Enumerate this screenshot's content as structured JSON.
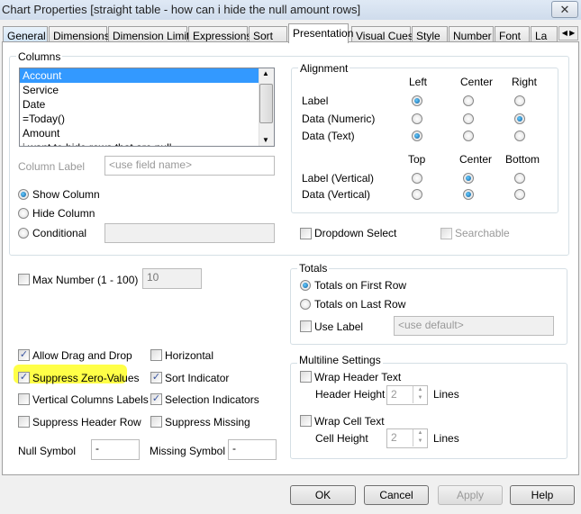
{
  "window": {
    "title": "Chart Properties [straight table - how can i hide the null amount rows]",
    "close": "✕"
  },
  "tabs": [
    "General",
    "Dimensions",
    "Dimension Limits",
    "Expressions",
    "Sort",
    "Presentation",
    "Visual Cues",
    "Style",
    "Number",
    "Font",
    "La"
  ],
  "active_tab": "Presentation",
  "columns": {
    "label": "Columns",
    "items": [
      "Account",
      "Service",
      "Date",
      "=Today()",
      "Amount",
      "i want to hide rows that are null"
    ],
    "selected": "Account",
    "column_label": "Column Label",
    "column_label_placeholder": "<use field name>",
    "show_column": "Show Column",
    "hide_column": "Hide Column",
    "conditional": "Conditional",
    "visibility_selected": "Show Column"
  },
  "alignment": {
    "label": "Alignment",
    "h_headers": [
      "Left",
      "Center",
      "Right"
    ],
    "v_headers": [
      "Top",
      "Center",
      "Bottom"
    ],
    "rows": [
      {
        "label": "Label",
        "selected": "Left"
      },
      {
        "label": "Data (Numeric)",
        "selected": "Right"
      },
      {
        "label": "Data (Text)",
        "selected": "Left"
      }
    ],
    "vrows": [
      {
        "label": "Label (Vertical)",
        "selected": "Center"
      },
      {
        "label": "Data (Vertical)",
        "selected": "Center"
      }
    ]
  },
  "dropdown_select": "Dropdown Select",
  "searchable": "Searchable",
  "max_number": {
    "label": "Max Number (1 - 100)",
    "value": "10"
  },
  "totals": {
    "label": "Totals",
    "first": "Totals on First Row",
    "last": "Totals on Last Row",
    "use_label": "Use Label",
    "placeholder": "<use default>",
    "selected": "first"
  },
  "options": [
    {
      "label": "Allow Drag and Drop",
      "checked": true
    },
    {
      "label": "Horizontal",
      "checked": false
    },
    {
      "label": "Suppress Zero-Values",
      "checked": true
    },
    {
      "label": "Sort Indicator",
      "checked": true
    },
    {
      "label": "Vertical Columns Labels",
      "checked": false
    },
    {
      "label": "Selection Indicators",
      "checked": true
    },
    {
      "label": "Suppress Header Row",
      "checked": false
    },
    {
      "label": "Suppress Missing",
      "checked": false
    }
  ],
  "null_symbol": {
    "label": "Null Symbol",
    "value": "-"
  },
  "missing_symbol": {
    "label": "Missing Symbol",
    "value": "-"
  },
  "multiline": {
    "label": "Multiline Settings",
    "wrap_header": "Wrap Header Text",
    "header_height": "Header Height",
    "header_value": "2",
    "wrap_cell": "Wrap Cell Text",
    "cell_height": "Cell Height",
    "cell_value": "2",
    "lines": "Lines"
  },
  "buttons": {
    "ok": "OK",
    "cancel": "Cancel",
    "apply": "Apply",
    "help": "Help"
  },
  "highlight_color": "#ffff33"
}
